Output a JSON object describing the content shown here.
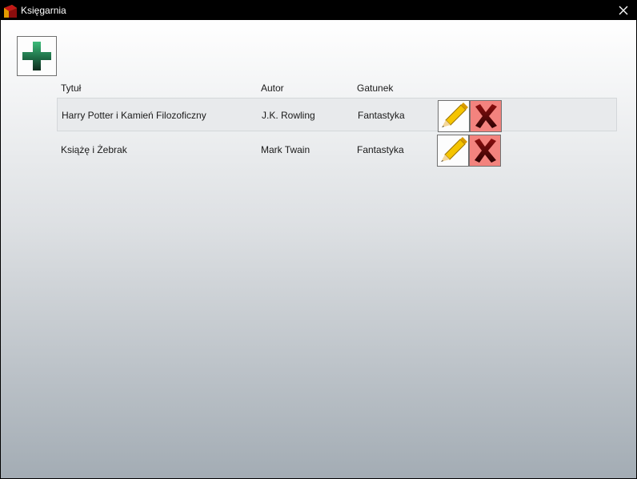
{
  "window": {
    "title": "Księgarnia",
    "close_icon": "close-icon"
  },
  "toolbar": {
    "add_icon": "plus-icon",
    "add_color": "#2e8b57"
  },
  "table": {
    "columns": [
      "Tytuł",
      "Autor",
      "Gatunek"
    ],
    "rows": [
      {
        "title": "Harry Potter i Kamień Filozoficzny",
        "author": "J.K. Rowling",
        "genre": "Fantastyka",
        "selected": true
      },
      {
        "title": "Książę i Żebrak",
        "author": "Mark Twain",
        "genre": "Fantastyka",
        "selected": false
      }
    ],
    "edit_icon": "pencil-icon",
    "delete_icon": "x-icon",
    "delete_color": "#f3837e"
  }
}
